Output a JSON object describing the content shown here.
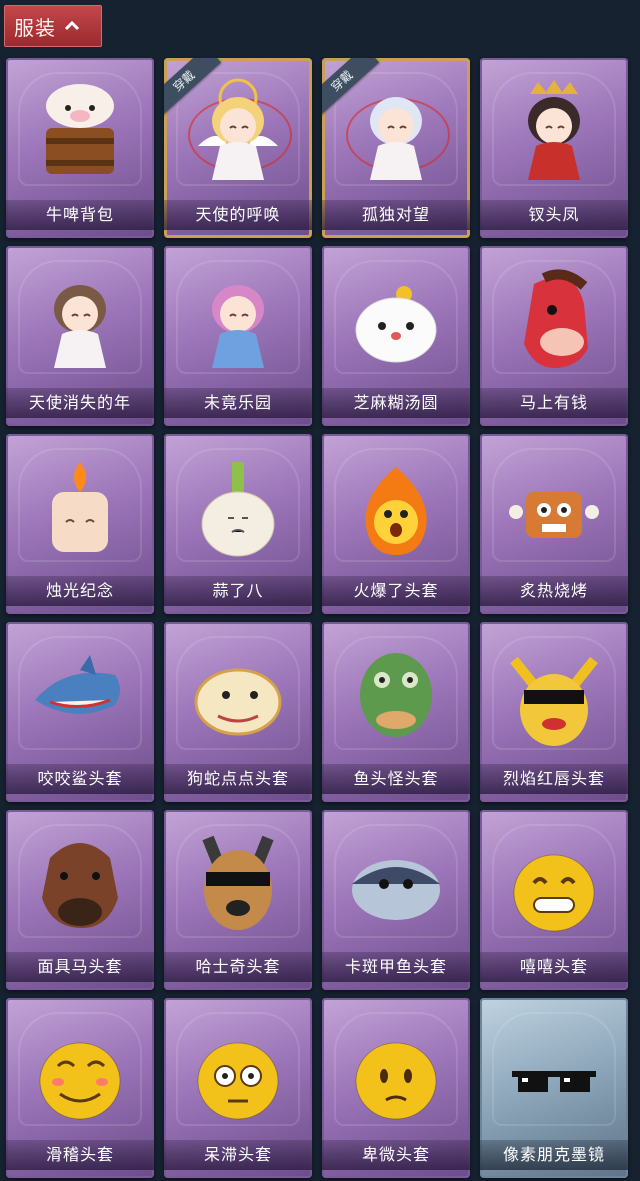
{
  "section": {
    "title": "服装",
    "toggle_icon": "chevron-up-icon"
  },
  "worn_badge": "穿戴",
  "items": [
    {
      "name": "牛啤背包",
      "icon": "cow-beer-backpack-icon",
      "worn": false
    },
    {
      "name": "天使的呼唤",
      "icon": "angel-doll-icon",
      "worn": true
    },
    {
      "name": "孤独对望",
      "icon": "silver-hair-doll-icon",
      "worn": true
    },
    {
      "name": "钗头凤",
      "icon": "phoenix-crown-doll-icon",
      "worn": false
    },
    {
      "name": "天使消失的年",
      "icon": "veiled-doll-icon",
      "worn": false
    },
    {
      "name": "未竟乐园",
      "icon": "pink-hair-doll-icon",
      "worn": false
    },
    {
      "name": "芝麻糊汤圆",
      "icon": "rice-ball-icon",
      "worn": false
    },
    {
      "name": "马上有钱",
      "icon": "red-horse-icon",
      "worn": false
    },
    {
      "name": "烛光纪念",
      "icon": "candle-icon",
      "worn": false
    },
    {
      "name": "蒜了八",
      "icon": "garlic-icon",
      "worn": false
    },
    {
      "name": "火爆了头套",
      "icon": "fire-head-icon",
      "worn": false
    },
    {
      "name": "炙热烧烤",
      "icon": "bbq-meat-icon",
      "worn": false
    },
    {
      "name": "咬咬鲨头套",
      "icon": "shark-head-icon",
      "worn": false
    },
    {
      "name": "狗蛇点点头套",
      "icon": "dog-snake-head-icon",
      "worn": false
    },
    {
      "name": "鱼头怪头套",
      "icon": "fish-monster-head-icon",
      "worn": false
    },
    {
      "name": "烈焰红唇头套",
      "icon": "yellow-mouse-sunglasses-icon",
      "worn": false
    },
    {
      "name": "面具马头套",
      "icon": "horse-mask-icon",
      "worn": false
    },
    {
      "name": "哈士奇头套",
      "icon": "husky-sunglasses-icon",
      "worn": false
    },
    {
      "name": "卡斑甲鱼头套",
      "icon": "catfish-head-icon",
      "worn": false
    },
    {
      "name": "嘻嘻头套",
      "icon": "grin-emoji-icon",
      "worn": false
    },
    {
      "name": "滑稽头套",
      "icon": "funny-emoji-icon",
      "worn": false
    },
    {
      "name": "呆滞头套",
      "icon": "dazed-emoji-icon",
      "worn": false
    },
    {
      "name": "卑微头套",
      "icon": "humble-emoji-icon",
      "worn": false
    },
    {
      "name": "像素朋克墨镜",
      "icon": "pixel-sunglasses-icon",
      "worn": false,
      "style": "blue"
    }
  ]
}
